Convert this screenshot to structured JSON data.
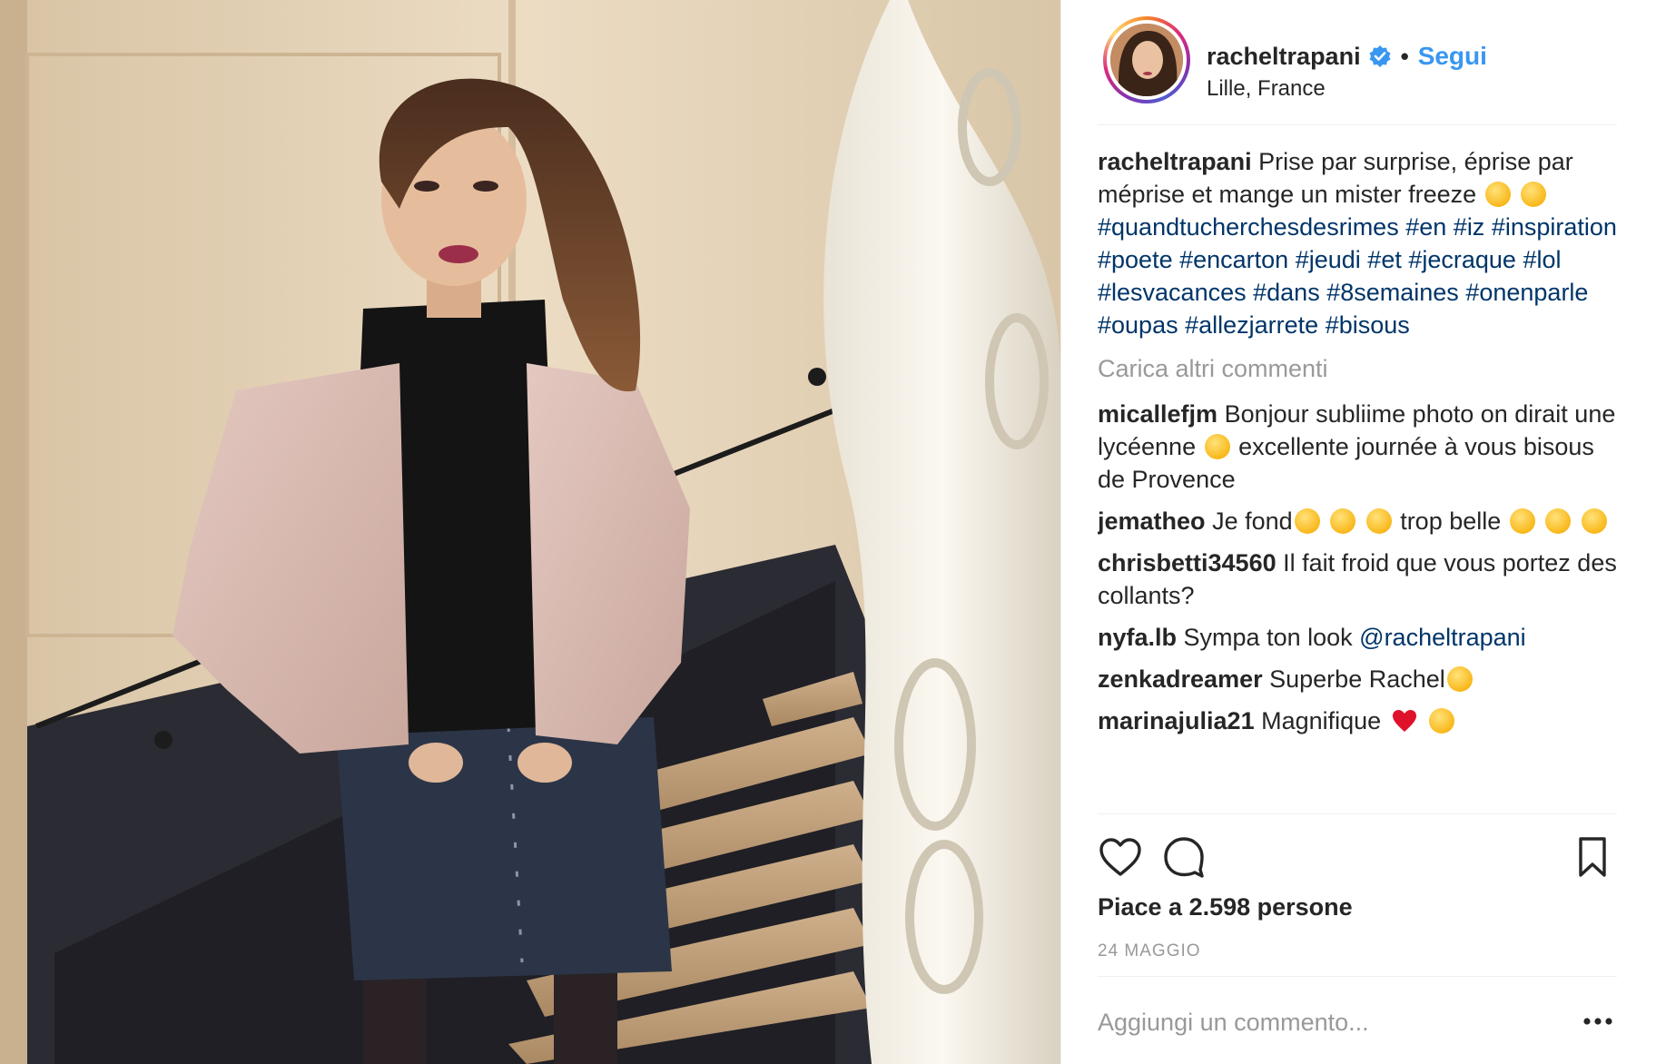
{
  "post": {
    "username": "racheltrapani",
    "follow_label": "Segui",
    "separator": "•",
    "location": "Lille, France"
  },
  "caption": {
    "username": "racheltrapani",
    "text": "Prise par surprise, éprise par méprise et mange un mister freeze",
    "hashtags": [
      "#quandtucherchesdesrimes",
      "#en",
      "#iz",
      "#inspiration",
      "#poete",
      "#encarton",
      "#jeudi",
      "#et",
      "#jecraque",
      "#lol",
      "#lesvacances",
      "#dans",
      "#8semaines",
      "#onenparle",
      "#oupas",
      "#allezjarrete",
      "#bisous"
    ]
  },
  "load_more_label": "Carica altri commenti",
  "comments": [
    {
      "username": "micallefjm",
      "text_a": "Bonjour subliime photo on dirait une lycéenne",
      "text_b": "excellente journée à vous bisous de Provence"
    },
    {
      "username": "jematheo",
      "text_a": "Je fond",
      "text_b": "trop belle"
    },
    {
      "username": "chrisbetti34560",
      "text_a": "Il fait froid que vous portez des collants?"
    },
    {
      "username": "nyfa.lb",
      "text_a": "Sympa ton look",
      "mention": "@racheltrapani"
    },
    {
      "username": "zenkadreamer",
      "text_a": "Superbe Rachel"
    },
    {
      "username": "marinajulia21",
      "text_a": "Magnifique"
    }
  ],
  "likes_text": "Piace a 2.598 persone",
  "date_text": "24 MAGGIO",
  "add_comment_placeholder": "Aggiungi un commento...",
  "icons": {
    "like": "heart-outline-icon",
    "comment": "speech-bubble-icon",
    "save": "bookmark-icon",
    "options": "more-options-icon",
    "verified": "verified-badge-icon"
  },
  "colors": {
    "link_blue": "#3897f0",
    "hashtag": "#003569",
    "muted": "#999999",
    "text": "#262626"
  }
}
